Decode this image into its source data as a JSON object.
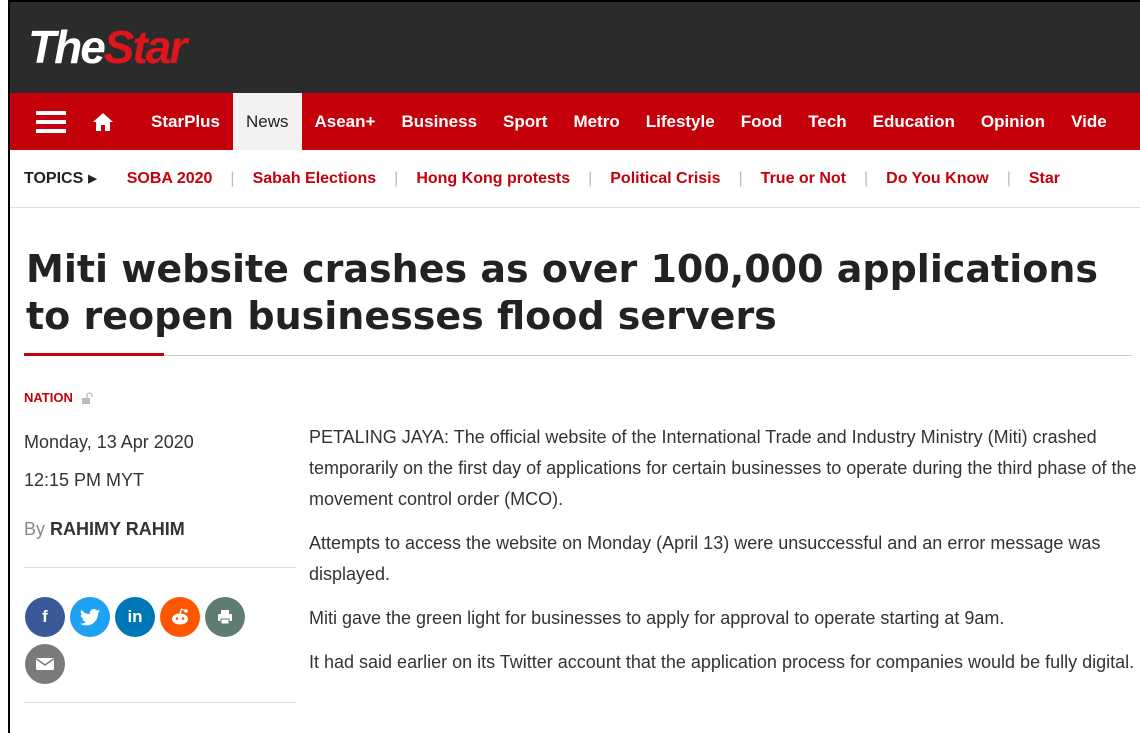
{
  "masthead": {
    "logo_the": "The",
    "logo_star": "Star"
  },
  "nav": {
    "items": [
      "StarPlus",
      "News",
      "Asean+",
      "Business",
      "Sport",
      "Metro",
      "Lifestyle",
      "Food",
      "Tech",
      "Education",
      "Opinion",
      "Vide"
    ],
    "active": "News"
  },
  "topics": {
    "label": "TOPICS",
    "items": [
      "SOBA 2020",
      "Sabah Elections",
      "Hong Kong protests",
      "Political Crisis",
      "True or Not",
      "Do You Know",
      "Star"
    ]
  },
  "article": {
    "headline": "Miti website crashes as over 100,000 applications to reopen businesses flood servers",
    "section": "NATION",
    "date": "Monday, 13 Apr 2020",
    "time": "12:15 PM MYT",
    "by_prefix": "By",
    "author": "RAHIMY RAHIM",
    "paragraphs": [
      "PETALING JAYA: The official website of the International Trade and Industry Ministry (Miti) crashed temporarily on the first day of applications for certain businesses to operate during the third phase of the movement control order (MCO).",
      "Attempts to access the website on Monday (April 13) were unsuccessful and an error message was displayed.",
      "Miti gave the green light for businesses to apply for approval to operate starting at 9am.",
      "It had said earlier on its Twitter account that the application process for companies would be fully digital."
    ]
  },
  "share": {
    "facebook": "f",
    "linkedin": "in"
  },
  "colors": {
    "brand_red": "#c4000b",
    "masthead_bg": "#2b2b2b"
  }
}
